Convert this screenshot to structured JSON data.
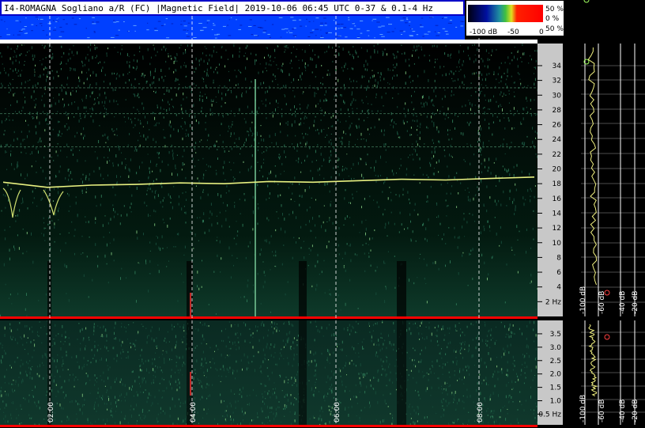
{
  "title": "I4-ROMAGNA  Sogliano a/R (FC) |Magnetic Field| 2019-10-06 06:45 UTC 0-37 & 0.1-4 Hz",
  "colors": {
    "title_border": "#0000c8",
    "red_line": "#ff0000",
    "trace": "#e8f080",
    "grid": "#ffffff",
    "axis_bg": "#c8c8c8"
  },
  "colorbar": {
    "labels": [
      "-100 dB",
      "-50",
      "0"
    ],
    "percent_labels": [
      "50 %",
      "0 %",
      "50 %"
    ]
  },
  "chart_data": [
    {
      "type": "heatmap",
      "title": "",
      "xlabel": "",
      "ylabel": "",
      "x_ticks": [
        "02:00",
        "04:00",
        "06:00",
        "08:00"
      ],
      "y_ticks": [
        "2 Hz",
        "4",
        "6",
        "8",
        "10",
        "12",
        "14",
        "16",
        "18",
        "20",
        "22",
        "24",
        "26",
        "28",
        "30",
        "32",
        "34"
      ],
      "ylim": [
        0,
        37
      ],
      "y_values": [
        2,
        4,
        6,
        8,
        10,
        12,
        14,
        16,
        18,
        20,
        22,
        24,
        26,
        28,
        30,
        32,
        34
      ],
      "spectrum_db_ticks": [
        "-100 dB",
        "-60 dB",
        "-40 dB",
        "-20 dB"
      ],
      "schumann_trace_hz": [
        18.2,
        17.5,
        17.8,
        17.9,
        18.1,
        18.0,
        18.3,
        18.2,
        18.4,
        18.6,
        18.5,
        18.7,
        18.9
      ]
    },
    {
      "type": "heatmap",
      "title": "",
      "xlabel": "",
      "ylabel": "",
      "x_ticks": [
        "02:00",
        "04:00",
        "06:00",
        "08:00"
      ],
      "y_ticks": [
        "0.5 Hz",
        "1.0",
        "1.5",
        "2.0",
        "2.5",
        "3.0",
        "3.5"
      ],
      "ylim": [
        0.1,
        4
      ],
      "y_values": [
        0.5,
        1.0,
        1.5,
        2.0,
        2.5,
        3.0,
        3.5
      ],
      "spectrum_db_ticks": [
        "-100 dB",
        "-60 dB",
        "-40 dB",
        "-20 dB"
      ]
    }
  ]
}
